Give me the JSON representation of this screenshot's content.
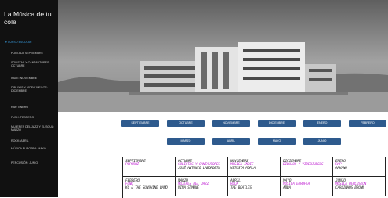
{
  "site": {
    "title": "La Música de tu cole"
  },
  "sidebar": {
    "toggle_label": "▾ CURSO ESCOLAR",
    "items": [
      {
        "label": "PORTADA SEPTIEMBRE"
      },
      {
        "label": "SOLISTAS Y CANTAUTORES: OCTUBRE"
      },
      {
        "label": "INDIE: NOVIEMBRE"
      },
      {
        "label": "DIBUJOS Y VIDEOJUEGOS: DICIEMBRE"
      },
      {
        "label": "RAP: ENERO"
      },
      {
        "label": "FUNK: FEBRERO"
      },
      {
        "label": "MUJERES DEL JAZZ Y EL SOUL: MARZO"
      },
      {
        "label": "ROCK: ABRIL"
      },
      {
        "label": "MÚSICA EUROPEA: MAYO"
      },
      {
        "label": "PERCUSIÓN: JUNIO"
      }
    ]
  },
  "buttons": {
    "row1": [
      "SEPTIEMBRE",
      "OCTUBRE",
      "NOVIEMBRE",
      "DICIEMBRE",
      "ENERO",
      "FEBRERO"
    ],
    "row2": [
      "MARZO",
      "ABRIL",
      "MAYO",
      "JUNIO"
    ]
  },
  "schedule": {
    "rows": [
      [
        {
          "month": "SEPTIEMBRE",
          "genre": "POPURRÍ",
          "artist": ""
        },
        {
          "month": "OCTUBRE",
          "genre": "SOLISTAS Y CANTAUTORES",
          "artist": "JOSÉ ANTONIO LABORDETA"
        },
        {
          "month": "NOVIEMBRE",
          "genre": "MÚSICA INDIE",
          "artist": "VETUSTA MORLA"
        },
        {
          "month": "DICIEMBRE",
          "genre": "DIBUJOS Y VIDEOJUEGOS",
          "artist": ""
        },
        {
          "month": "ENERO",
          "genre": "RAP",
          "artist": "ARKANO"
        }
      ],
      [
        {
          "month": "FEBRERO",
          "genre": "FUNK",
          "artist": "KC & THE SUNSHINE BAND"
        },
        {
          "month": "MARZO",
          "genre": "MUJERES DEL JAZZ",
          "artist": "NINA SIMONE"
        },
        {
          "month": "ABRIL",
          "genre": "ROCK",
          "artist": "THE BEATLES"
        },
        {
          "month": "MAYO",
          "genre": "MÚSICA EUROPEA",
          "artist": "ABBA"
        },
        {
          "month": "JUNIO",
          "genre": "MÚSICA PERCUSIÓN",
          "artist": "CARLINHOS BROWN"
        }
      ]
    ]
  },
  "colors": {
    "sidebar_bg": "#111111",
    "accent_link": "#3aa2e8",
    "button_bg": "#2e5a8d",
    "genre_text": "#c026d3"
  }
}
